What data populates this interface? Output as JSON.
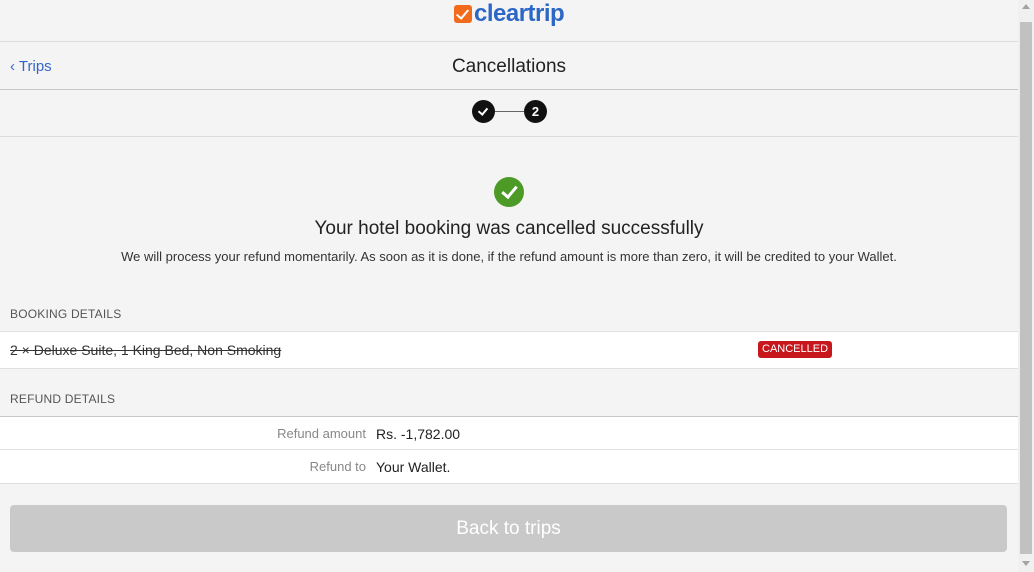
{
  "logo": {
    "text": "cleartrip",
    "icon": "check-box-icon"
  },
  "nav": {
    "back_label": "‹ Trips",
    "title": "Cancellations"
  },
  "steps": {
    "step1_icon": "checkmark-icon",
    "step2_label": "2"
  },
  "success": {
    "icon": "check-circle-icon",
    "title": "Your hotel booking was cancelled successfully",
    "message": "We will process your refund momentarily. As soon as it is done, if the refund amount is more than zero, it will be credited to your Wallet."
  },
  "booking": {
    "section_title": "BOOKING DETAILS",
    "room": "2 × Deluxe Suite, 1 King Bed, Non Smoking",
    "status": "CANCELLED"
  },
  "refund": {
    "section_title": "REFUND DETAILS",
    "amount_label": "Refund amount",
    "amount_value": "Rs. -1,782.00",
    "to_label": "Refund to",
    "to_value": "Your Wallet."
  },
  "actions": {
    "back_button": "Back to trips"
  },
  "colors": {
    "brand_blue": "#2d67c6",
    "brand_orange": "#f26b1d",
    "success_green": "#4e9a26",
    "cancel_red": "#c8161d"
  }
}
